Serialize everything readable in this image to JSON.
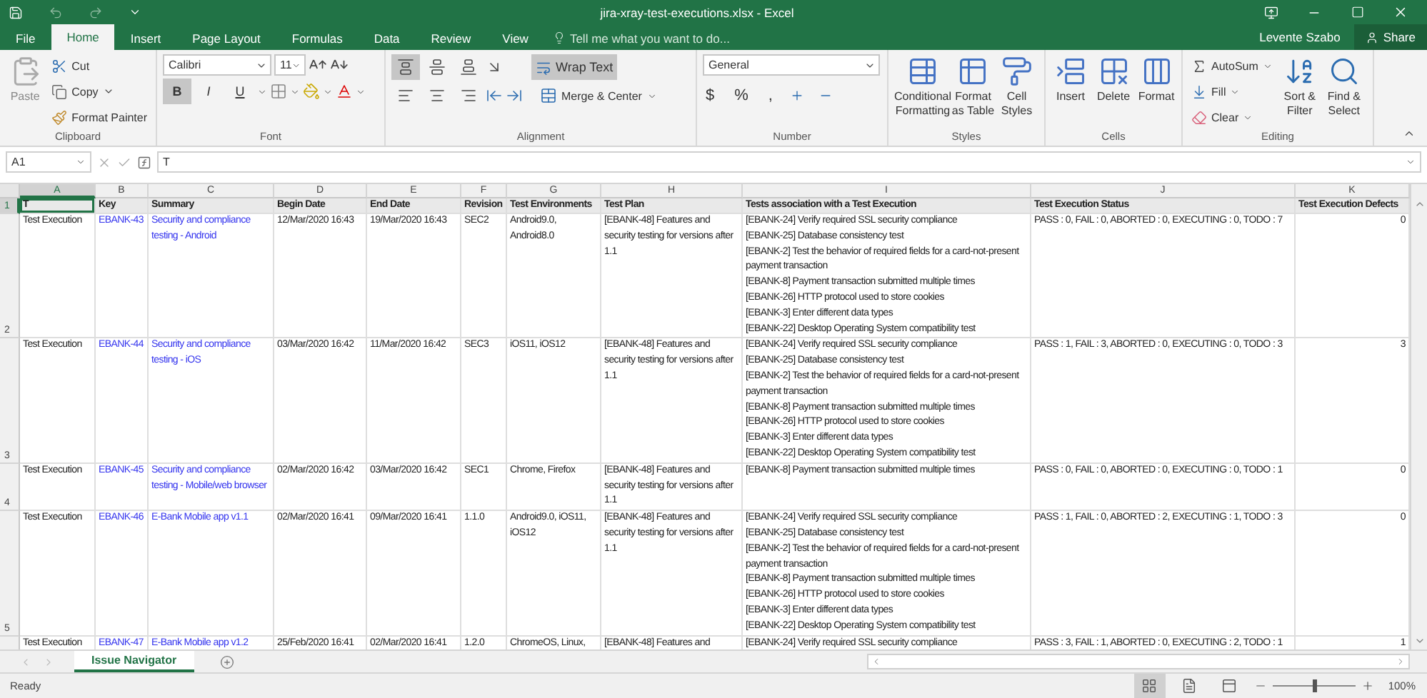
{
  "window": {
    "title": "jira-xray-test-executions.xlsx - Excel",
    "user": "Levente Szabo",
    "share": "Share"
  },
  "ribbon_tabs": [
    {
      "label": "File",
      "selected": false
    },
    {
      "label": "Home",
      "selected": true
    },
    {
      "label": "Insert",
      "selected": false
    },
    {
      "label": "Page Layout",
      "selected": false
    },
    {
      "label": "Formulas",
      "selected": false
    },
    {
      "label": "Data",
      "selected": false
    },
    {
      "label": "Review",
      "selected": false
    },
    {
      "label": "View",
      "selected": false
    }
  ],
  "tell_me": {
    "placeholder": "Tell me what you want to do..."
  },
  "ribbon": {
    "clipboard": {
      "label": "Clipboard",
      "paste": "Paste",
      "cut": "Cut",
      "copy": "Copy",
      "format_painter": "Format Painter"
    },
    "font": {
      "label": "Font",
      "name": "Calibri",
      "size": "11",
      "bold": {
        "text": "B",
        "on": true
      },
      "italic": {
        "text": "I",
        "on": false
      },
      "underline": {
        "text": "U",
        "on": false
      }
    },
    "alignment": {
      "label": "Alignment",
      "vertical_align": [
        {
          "selected": true
        },
        {
          "selected": false
        },
        {
          "selected": false
        }
      ],
      "wrap_text": {
        "label": "Wrap Text",
        "on": true
      },
      "merge": "Merge & Center"
    },
    "number": {
      "label": "Number",
      "format": "General",
      "symbols": [
        "$",
        "%",
        ","
      ]
    },
    "styles": {
      "label": "Styles",
      "buttons": [
        "Conditional Formatting",
        "Format as Table",
        "Cell Styles"
      ]
    },
    "cells": {
      "label": "Cells",
      "buttons": [
        "Insert",
        "Delete",
        "Format"
      ]
    },
    "editing": {
      "label": "Editing",
      "autosum": "AutoSum",
      "fill": "Fill",
      "clear": "Clear",
      "buttons": [
        "Sort & Filter",
        "Find & Select"
      ]
    }
  },
  "formula_bar": {
    "name_box": "A1",
    "formula": "T"
  },
  "grid": {
    "columns": [
      {
        "letter": "A",
        "selected": true
      },
      {
        "letter": "B",
        "selected": false
      },
      {
        "letter": "C",
        "selected": false
      },
      {
        "letter": "D",
        "selected": false
      },
      {
        "letter": "E",
        "selected": false
      },
      {
        "letter": "F",
        "selected": false
      },
      {
        "letter": "G",
        "selected": false
      },
      {
        "letter": "H",
        "selected": false
      },
      {
        "letter": "I",
        "selected": false
      },
      {
        "letter": "J",
        "selected": false
      },
      {
        "letter": "K",
        "selected": false
      }
    ],
    "header_row": {
      "number": "1",
      "selected": true,
      "cells": [
        "T",
        "Key",
        "Summary",
        "Begin Date",
        "End Date",
        "Revision",
        "Test Environments",
        "Test Plan",
        "Tests association with a Test Execution",
        "Test Execution Status",
        "Test Execution Defects"
      ]
    },
    "rows": [
      {
        "number": "2",
        "selected": false,
        "type": "Test Execution",
        "key": "EBANK-43",
        "summary": "Security and compliance testing - Android",
        "begin": "12/Mar/2020 16:43",
        "end": "19/Mar/2020 16:43",
        "revision": "SEC2",
        "environments": "Android9.0, Android8.0",
        "test_plan": "[EBANK-48] Features and security testing for versions after 1.1",
        "tests": [
          "[EBANK-24] Verify required SSL security compliance",
          "[EBANK-25] Database consistency test",
          "[EBANK-2] Test the behavior of required fields for a card-not-present payment transaction",
          "[EBANK-8] Payment transaction submitted multiple times",
          "[EBANK-26] HTTP protocol used to store cookies",
          "[EBANK-3] Enter different data types",
          "[EBANK-22] Desktop Operating System compatibility test"
        ],
        "status": "PASS : 0, FAIL : 0, ABORTED : 0, EXECUTING : 0, TODO : 7",
        "defects": "0"
      },
      {
        "number": "3",
        "selected": false,
        "type": "Test Execution",
        "key": "EBANK-44",
        "summary": "Security and compliance testing - iOS",
        "begin": "03/Mar/2020 16:42",
        "end": "11/Mar/2020 16:42",
        "revision": "SEC3",
        "environments": "iOS11, iOS12",
        "test_plan": "[EBANK-48] Features and security testing for versions after 1.1",
        "tests": [
          "[EBANK-24] Verify required SSL security compliance",
          "[EBANK-25] Database consistency test",
          "[EBANK-2] Test the behavior of required fields for a card-not-present payment transaction",
          "[EBANK-8] Payment transaction submitted multiple times",
          "[EBANK-26] HTTP protocol used to store cookies",
          "[EBANK-3] Enter different data types",
          "[EBANK-22] Desktop Operating System compatibility test"
        ],
        "status": "PASS : 1, FAIL : 3, ABORTED : 0, EXECUTING : 0, TODO : 3",
        "defects": "3"
      },
      {
        "number": "4",
        "selected": false,
        "type": "Test Execution",
        "key": "EBANK-45",
        "summary": "Security and compliance testing - Mobile/web browser",
        "begin": "02/Mar/2020 16:42",
        "end": "03/Mar/2020 16:42",
        "revision": "SEC1",
        "environments": "Chrome, Firefox",
        "test_plan": "[EBANK-48] Features and security testing for versions after 1.1",
        "tests": [
          "[EBANK-8] Payment transaction submitted multiple times"
        ],
        "status": "PASS : 0, FAIL : 0, ABORTED : 0, EXECUTING : 0, TODO : 1",
        "defects": "0"
      },
      {
        "number": "5",
        "selected": false,
        "type": "Test Execution",
        "key": "EBANK-46",
        "summary": "E-Bank Mobile app v1.1",
        "begin": "02/Mar/2020 16:41",
        "end": "09/Mar/2020 16:41",
        "revision": "1.1.0",
        "environments": "Android9.0, iOS11, iOS12",
        "test_plan": "[EBANK-48] Features and security testing for versions after 1.1",
        "tests": [
          "[EBANK-24] Verify required SSL security compliance",
          "[EBANK-25] Database consistency test",
          "[EBANK-2] Test the behavior of required fields for a card-not-present payment transaction",
          "[EBANK-8] Payment transaction submitted multiple times",
          "[EBANK-26] HTTP protocol used to store cookies",
          "[EBANK-3] Enter different data types",
          "[EBANK-22] Desktop Operating System compatibility test"
        ],
        "status": "PASS : 1, FAIL : 0, ABORTED : 2, EXECUTING : 1, TODO : 3",
        "defects": "0"
      },
      {
        "selected": false,
        "type": "Test Execution",
        "key": "EBANK-47",
        "summary": "E-Bank Mobile app v1.2",
        "begin": "25/Feb/2020 16:41",
        "end": "02/Mar/2020 16:41",
        "revision": "1.2.0",
        "environments": "ChromeOS, Linux,",
        "test_plan": "[EBANK-48] Features and",
        "tests": [
          "[EBANK-24] Verify required SSL security compliance"
        ],
        "status": "PASS : 3, FAIL : 1, ABORTED : 0, EXECUTING : 2, TODO : 1",
        "defects": "1"
      }
    ]
  },
  "sheet_tabs": [
    {
      "label": "Issue Navigator",
      "selected": true
    }
  ],
  "status_bar": {
    "text": "Ready",
    "views": [
      {
        "selected": true
      },
      {
        "selected": false
      },
      {
        "selected": false
      }
    ],
    "zoom": {
      "level": 0.5,
      "reading": "100%"
    }
  }
}
